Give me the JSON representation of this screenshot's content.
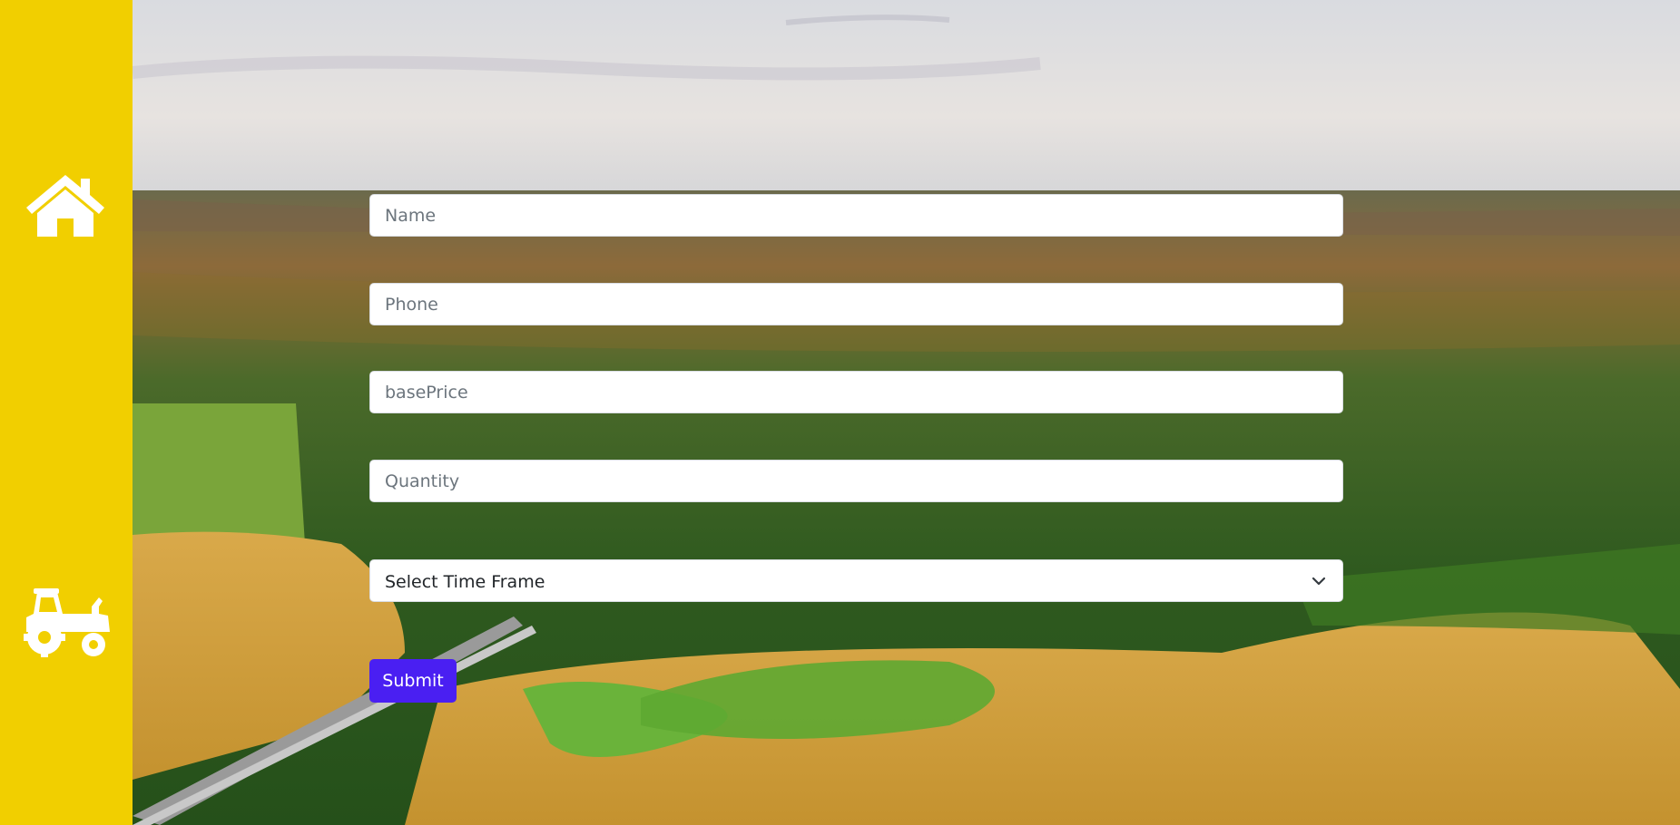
{
  "sidebar": {
    "items": [
      {
        "name": "home",
        "icon": "home-icon"
      },
      {
        "name": "tractor",
        "icon": "tractor-icon"
      }
    ],
    "background_color": "#f1cf00"
  },
  "form": {
    "name_placeholder": "Name",
    "phone_placeholder": "Phone",
    "base_price_placeholder": "basePrice",
    "quantity_placeholder": "Quantity",
    "time_frame_selected": "Select Time Frame",
    "submit_label": "Submit"
  },
  "colors": {
    "accent": "#4a1ff2",
    "sidebar": "#f1cf00",
    "field_background": "#ffffff"
  }
}
